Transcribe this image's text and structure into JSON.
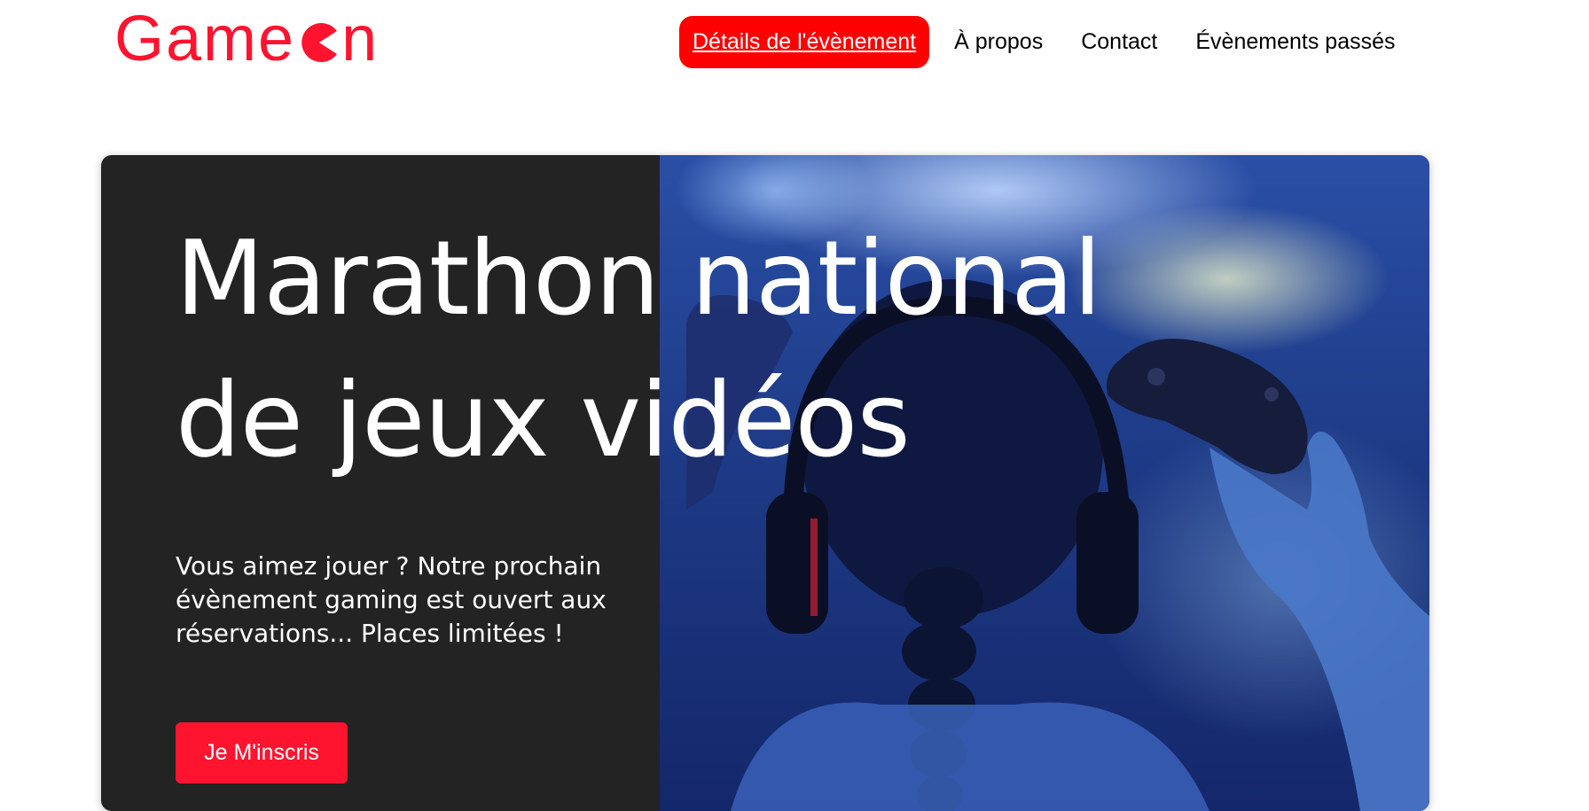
{
  "brand": {
    "logo_prefix": "Game",
    "logo_suffix": "n",
    "color": "#fe142f"
  },
  "nav": {
    "items": [
      {
        "label": "Détails de l'évènement",
        "active": true
      },
      {
        "label": "À propos",
        "active": false
      },
      {
        "label": "Contact",
        "active": false
      },
      {
        "label": "Évènements passés",
        "active": false
      }
    ],
    "active_color": "#ff0000"
  },
  "hero": {
    "title_line1": "Marathon national",
    "title_line2": "de jeux vidéos",
    "text": "Vous aimez jouer ? Notre prochain évènement gaming est ouvert aux réservations... Places limitées !",
    "cta_label": "Je M'inscris",
    "background": "#232323",
    "image_description_icon": "gamer-photo"
  }
}
